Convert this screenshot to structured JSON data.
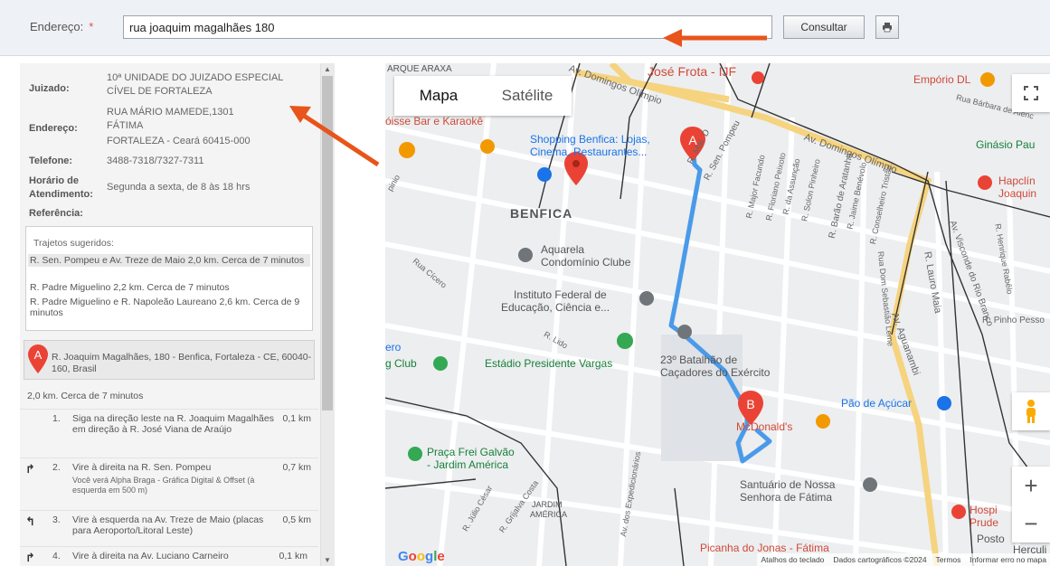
{
  "toolbar": {
    "address_label": "Endereço:",
    "required_mark": "*",
    "address_value": "rua joaquim magalhães 180",
    "consult_label": "Consultar",
    "print_icon": "printer-icon"
  },
  "court": {
    "juizado_label": "Juizado:",
    "juizado_value_1": "10ª UNIDADE DO JUIZADO ESPECIAL",
    "juizado_value_2": "CÍVEL DE FORTALEZA",
    "endereco_label": "Endereço:",
    "endereco_value_1": "RUA MÁRIO MAMEDE,1301",
    "endereco_value_2": "FÁTIMA",
    "endereco_value_3": "FORTALEZA - Ceará  60415-000",
    "telefone_label": "Telefone:",
    "telefone_value": "3488-7318/7327-7311",
    "horario_label_1": "Horário de",
    "horario_label_2": "Atendimento:",
    "horario_value": "Segunda a sexta, de 8 às 18 hrs",
    "referencia_label": "Referência:"
  },
  "routes": {
    "title": "Trajetos sugeridos:",
    "items": [
      {
        "text": "R. Sen. Pompeu e Av. Treze de Maio 2,0 km. Cerca de 7 minutos"
      },
      {
        "text": "R. Padre Miguelino 2,2 km. Cerca de 7 minutos"
      },
      {
        "text": "R. Padre Miguelino e R. Napoleão Laureano 2,6 km. Cerca de 9 minutos"
      }
    ]
  },
  "origin": {
    "marker": "A",
    "text": "R. Joaquim Magalhães, 180 - Benfica, Fortaleza - CE, 60040-160, Brasil"
  },
  "summary": "2,0 km. Cerca de 7 minutos",
  "steps": [
    {
      "num": "1.",
      "text": "Siga na direção leste na R. Joaquim Magalhães em direção à R. José Viana de Araújo",
      "sub": "",
      "dist": "0,1 km"
    },
    {
      "num": "2.",
      "text": "Vire à direita na R. Sen. Pompeu",
      "sub": "Você verá Alpha Braga - Gráfica Digital & Offset (à esquerda em 500 m)",
      "dist": "0,7 km"
    },
    {
      "num": "3.",
      "text": "Vire à esquerda na Av. Treze de Maio (placas para Aeroporto/Litoral Leste)",
      "sub": "",
      "dist": "0,5 km"
    },
    {
      "num": "4.",
      "text": "Vire à direita na Av. Luciano Carneiro",
      "sub": "",
      "dist": "0,1 km"
    }
  ],
  "map": {
    "type_map": "Mapa",
    "type_satellite": "Satélite",
    "labels": {
      "parque": "ARQUE ARAXA",
      "jose_frota": "José Frota - IJF",
      "emporio": "Empório DL",
      "boisse": "óisse Bar e Karaokê",
      "shopping_1": "Shopping Benfica: Lojas,",
      "shopping_2": "Cinema, Restaurantes...",
      "ginasio": "Ginásio Pau",
      "hapclin_1": "Hapclín",
      "hapclin_2": "Joaquin",
      "benfica": "BENFICA",
      "aquarela_1": "Aquarela",
      "aquarela_2": "Condomínio Clube",
      "instituto_1": "Instituto Federal de",
      "instituto_2": "Educação, Ciência e...",
      "ceara": "ero",
      "club": "g Club",
      "estadio": "Estádio Presidente Vargas",
      "batalhao_1": "23º Batalhão de",
      "batalhao_2": "Caçadores do Exército",
      "mcdonalds": "McDonald's",
      "pao": "Pão de Açúcar",
      "praca_1": "Praça Frei Galvão",
      "praca_2": "- Jardim América",
      "santuario_1": "Santuário de Nossa",
      "santuario_2": "Senhora de Fátima",
      "jardim_1": "JARDIM",
      "jardim_2": "AMÉRICA",
      "hospi_1": "Hospi",
      "hospi_2": "Prude",
      "posto": "Posto",
      "picanha": "Picanha do Jonas - Fátima",
      "herculi": "Herculi",
      "av_domingos_1": "Av. Domingos Olímpio",
      "av_domingos_2": "Av. Domingos Olímpio",
      "r_sen_pompeu": "R. Sen. Pompeu",
      "r_mal_d": "R. Mal. D",
      "r_barao": "R. Barão de Aratanha",
      "r_lauro": "R. Lauro Maia",
      "av_aguanambi": "Av. Aguanambi",
      "av_visconde": "Av. Visconde do Rio Branco",
      "r_pinho": "R. Pinho Pesso",
      "r_barbara": "Rua Bárbara de Alenc",
      "r_major": "R. Major Facundo",
      "r_floriano": "R. Floriano Peixoto",
      "r_assuncao": "R. da Assunção",
      "r_solon": "R. Solon Pinheiro",
      "r_jaime": "R. Jaime Benévolo",
      "r_conselheiro": "R. Conselheiro Tristão",
      "r_dom": "Rua Dom Sebastião Leme",
      "r_henrique": "R. Henrique Rabêlo",
      "r_cicero": "Rua Cícero",
      "r_julio": "R. Júlio César",
      "r_grijalva": "R. Grijalva Costa",
      "r_expedicionarios": "Av. dos Expedicionários",
      "r_lido": "R. Lido",
      "r_sao": "pinio"
    },
    "marker_a": "A",
    "marker_b": "B",
    "footer_shortcuts": "Atalhos do teclado",
    "footer_data": "Dados cartográficos ©2024",
    "footer_terms": "Termos",
    "footer_report": "Informar erro no mapa",
    "logo": "Google",
    "zoom_in": "+",
    "zoom_out": "−",
    "colors": {
      "route": "#4a9ae9",
      "arterial": "#f6d37e",
      "pin_red": "#ea4335"
    }
  }
}
